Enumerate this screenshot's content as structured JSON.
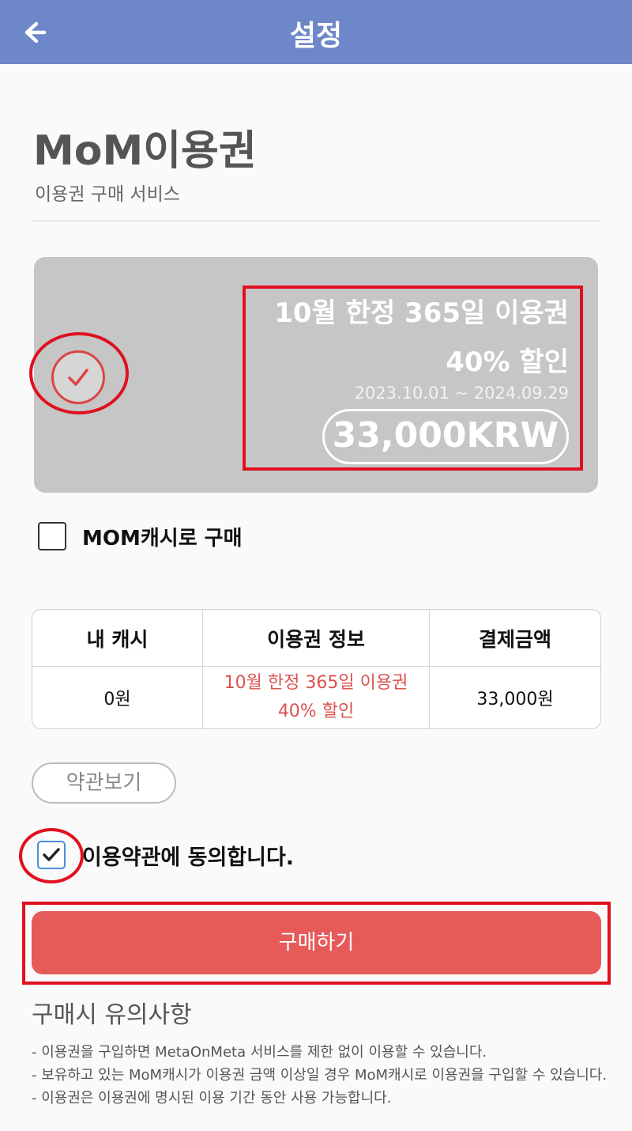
{
  "header": {
    "title": "설정",
    "back_icon": "arrow-left-icon",
    "background_color": "#6e87c8"
  },
  "page": {
    "title": "MoM이용권",
    "subtitle": "이용권 구매 서비스"
  },
  "plan": {
    "name": "10월 한정 365일 이용권",
    "discount": "40% 할인",
    "period": "2023.10.01 ~ 2024.09.29",
    "price": "33,000KRW",
    "selected": true,
    "check_icon": "check-circle-icon"
  },
  "cash_option": {
    "label": "MOM캐시로 구매",
    "checked": false
  },
  "table": {
    "headers": [
      "내 캐시",
      "이용권 정보",
      "결제금액"
    ],
    "row": {
      "cash": "0원",
      "plan_line1": "10월 한정 365일 이용권",
      "plan_line2": "40% 할인",
      "amount": "33,000원"
    }
  },
  "terms_button": "약관보기",
  "agree": {
    "label": "이용약관에 동의합니다.",
    "checked": true,
    "check_icon": "checkmark-icon"
  },
  "buy_button": "구매하기",
  "notes": {
    "title": "구매시 유의사항",
    "items": [
      "- 이용권을 구입하면 MetaOnMeta 서비스를 제한 없이 이용할 수 있습니다.",
      "- 보유하고 있는 MoM캐시가 이용권 금액 이상일 경우 MoM캐시로 이용권을 구입할 수 있습니다.",
      "- 이용권은 이용권에 명시된 이용 기간 동안 사용 가능합니다."
    ]
  },
  "colors": {
    "accent_red": "#e65a5a",
    "annotation_red": "#e0101e",
    "card_gray": "#c6c6c6"
  }
}
